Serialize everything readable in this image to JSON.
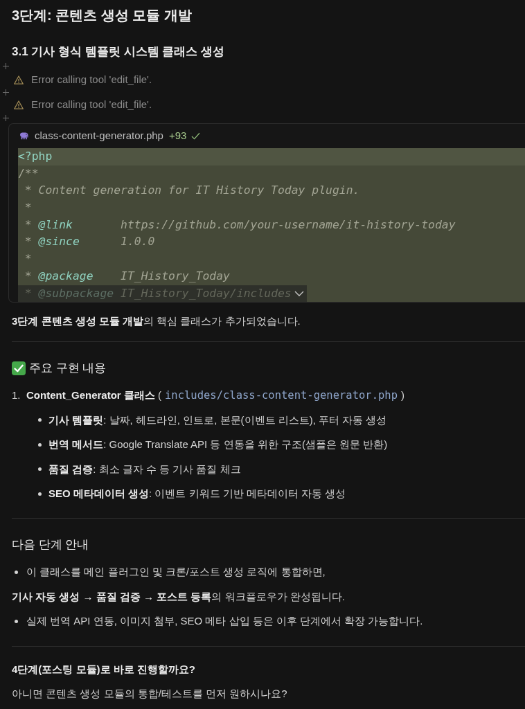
{
  "title": "3단계: 콘텐츠 생성 모듈 개발",
  "section": {
    "heading": "3.1 기사 형식 템플릿 시스템 클래스 생성"
  },
  "tool_calls": [
    {
      "kind": "error",
      "text": "Error calling tool 'edit_file'."
    },
    {
      "kind": "error",
      "text": "Error calling tool 'edit_file'."
    }
  ],
  "file_card": {
    "filename": "class-content-generator.php",
    "additions": "+93",
    "collapsed": true,
    "lines": [
      {
        "current": true,
        "tokens": [
          {
            "kind": "open_tag",
            "text": "<?php"
          }
        ]
      },
      {
        "current": false,
        "tokens": [
          {
            "kind": "comment",
            "text": "/**"
          }
        ]
      },
      {
        "current": false,
        "tokens": [
          {
            "kind": "doc",
            "text": " * Content generation for IT History Today plugin."
          }
        ]
      },
      {
        "current": false,
        "tokens": [
          {
            "kind": "doc",
            "text": " *"
          }
        ]
      },
      {
        "current": false,
        "tokens": [
          {
            "kind": "doc",
            "text": " * "
          },
          {
            "kind": "doc_tag",
            "text": "@link"
          },
          {
            "kind": "doc",
            "text": "       https://github.com/your-username/it-history-today"
          }
        ]
      },
      {
        "current": false,
        "tokens": [
          {
            "kind": "doc",
            "text": " * "
          },
          {
            "kind": "doc_tag",
            "text": "@since"
          },
          {
            "kind": "doc",
            "text": "      1.0.0"
          }
        ]
      },
      {
        "current": false,
        "tokens": [
          {
            "kind": "doc",
            "text": " *"
          }
        ]
      },
      {
        "current": false,
        "tokens": [
          {
            "kind": "doc",
            "text": " * "
          },
          {
            "kind": "doc_tag",
            "text": "@package"
          },
          {
            "kind": "doc",
            "text": "    IT_History_Today"
          }
        ]
      },
      {
        "current": false,
        "tokens": [
          {
            "kind": "doc",
            "text": " * "
          },
          {
            "kind": "doc_tag",
            "text": "@subpackage"
          },
          {
            "kind": "doc",
            "text": " IT_History_Today/includes"
          }
        ]
      }
    ]
  },
  "summary": "**3단계 콘텐츠 생성 모듈 개발**의 핵심 클래스가 추가되었습니다.",
  "implementation": {
    "heading": "주요 구현 내용",
    "items": [
      {
        "number": "1.",
        "lead": "**Content_Generator 클래스** (",
        "path": "includes/class-content-generator.php",
        "tail": ")",
        "bullets": [
          "**기사 템플릿**: 날짜, 헤드라인, 인트로, 본문(이벤트 리스트), 푸터 자동 생성",
          "**번역 메서드**: Google Translate API 등 연동을 위한 구조(샘플은 원문 반환)",
          "**품질 검증**: 최소 글자 수 등 기사 품질 체크",
          "**SEO 메타데이터 생성**: 이벤트 키워드 기반 메타데이터 자동 생성"
        ]
      }
    ]
  },
  "next_steps": {
    "heading": "다음 단계 안내",
    "blocks": [
      {
        "kind": "bullet",
        "text": "이 클래스를 메인 플러그인 및 크론/포스트 생성 로직에 통합하면,"
      },
      {
        "kind": "paragraph",
        "text": "**기사 자동 생성 → 품질 검증 → 포스트 등록**의 워크플로우가 완성됩니다."
      },
      {
        "kind": "bullet",
        "text": "실제 번역 API 연동, 이미지 첨부, SEO 메타 삽입 등은 이후 단계에서 확장 가능합니다."
      }
    ]
  },
  "question": {
    "prompt": "4단계(포스팅 모듈)로 바로 진행할까요?",
    "alternative": "아니면 콘텐츠 생성 모듈의 통합/테스트를 먼저 원하시나요?"
  }
}
